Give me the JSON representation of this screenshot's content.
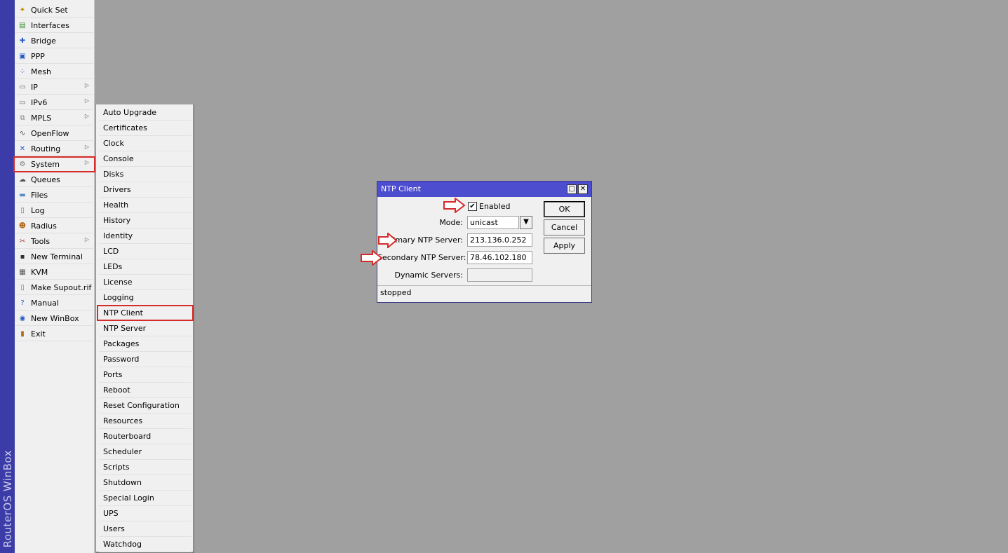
{
  "brand": "RouterOS WinBox",
  "main_menu": [
    {
      "label": "Quick Set",
      "icon": "wand-icon",
      "submenu": false
    },
    {
      "label": "Interfaces",
      "icon": "interfaces-icon",
      "submenu": false
    },
    {
      "label": "Bridge",
      "icon": "bridge-icon",
      "submenu": false
    },
    {
      "label": "PPP",
      "icon": "ppp-icon",
      "submenu": false
    },
    {
      "label": "Mesh",
      "icon": "mesh-icon",
      "submenu": false
    },
    {
      "label": "IP",
      "icon": "ip-icon",
      "submenu": true
    },
    {
      "label": "IPv6",
      "icon": "ipv6-icon",
      "submenu": true
    },
    {
      "label": "MPLS",
      "icon": "mpls-icon",
      "submenu": true
    },
    {
      "label": "OpenFlow",
      "icon": "openflow-icon",
      "submenu": false
    },
    {
      "label": "Routing",
      "icon": "routing-icon",
      "submenu": true
    },
    {
      "label": "System",
      "icon": "gear-icon",
      "submenu": true
    },
    {
      "label": "Queues",
      "icon": "queues-icon",
      "submenu": false
    },
    {
      "label": "Files",
      "icon": "folder-icon",
      "submenu": false
    },
    {
      "label": "Log",
      "icon": "log-icon",
      "submenu": false
    },
    {
      "label": "Radius",
      "icon": "users-icon",
      "submenu": false
    },
    {
      "label": "Tools",
      "icon": "tools-icon",
      "submenu": true
    },
    {
      "label": "New Terminal",
      "icon": "terminal-icon",
      "submenu": false
    },
    {
      "label": "KVM",
      "icon": "kvm-icon",
      "submenu": false
    },
    {
      "label": "Make Supout.rif",
      "icon": "document-icon",
      "submenu": false
    },
    {
      "label": "Manual",
      "icon": "help-icon",
      "submenu": false
    },
    {
      "label": "New WinBox",
      "icon": "winbox-icon",
      "submenu": false
    },
    {
      "label": "Exit",
      "icon": "exit-door-icon",
      "submenu": false
    }
  ],
  "system_submenu": [
    "Auto Upgrade",
    "Certificates",
    "Clock",
    "Console",
    "Disks",
    "Drivers",
    "Health",
    "History",
    "Identity",
    "LCD",
    "LEDs",
    "License",
    "Logging",
    "NTP Client",
    "NTP Server",
    "Packages",
    "Password",
    "Ports",
    "Reboot",
    "Reset Configuration",
    "Resources",
    "Routerboard",
    "Scheduler",
    "Scripts",
    "Shutdown",
    "Special Login",
    "UPS",
    "Users",
    "Watchdog"
  ],
  "dialog": {
    "title": "NTP Client",
    "enabled_label": "Enabled",
    "enabled_checked": true,
    "mode_label": "Mode:",
    "mode_value": "unicast",
    "primary_label": "Primary NTP Server:",
    "primary_value": "213.136.0.252",
    "secondary_label": "Secondary NTP Server:",
    "secondary_value": "78.46.102.180",
    "dynamic_label": "Dynamic Servers:",
    "dynamic_value": "",
    "ok_label": "OK",
    "cancel_label": "Cancel",
    "apply_label": "Apply",
    "status": "stopped"
  },
  "colors": {
    "highlight": "#d62b2b",
    "title_bar": "#4d4dcf",
    "brand_strip": "#3c3ca8"
  }
}
